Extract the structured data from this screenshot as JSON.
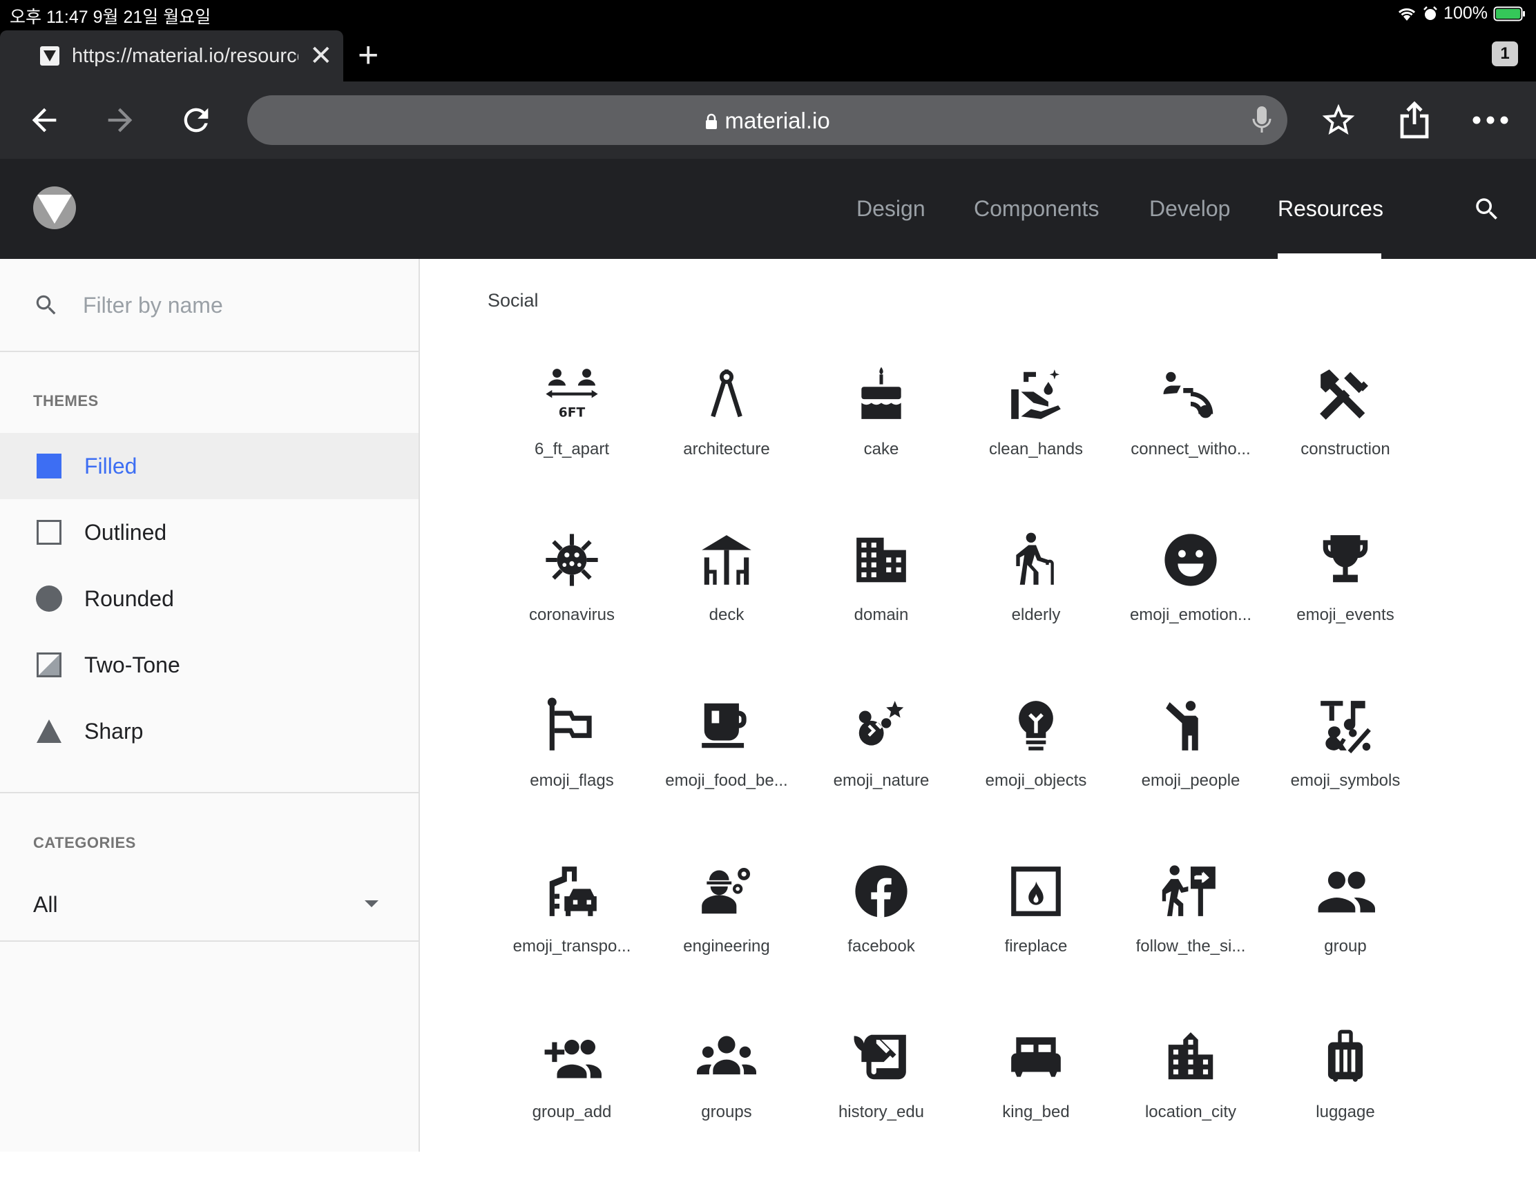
{
  "status_bar": {
    "time_date": "오후 11:47   9월 21일 월요일",
    "battery": "100%"
  },
  "tab": {
    "title": "https://material.io/resources/icons/",
    "close": "✕",
    "new_tab": "+",
    "count": "1"
  },
  "address_bar": {
    "url": "material.io"
  },
  "header": {
    "nav": [
      {
        "label": "Design"
      },
      {
        "label": "Components"
      },
      {
        "label": "Develop"
      },
      {
        "label": "Resources"
      }
    ]
  },
  "sidebar": {
    "filter_placeholder": "Filter by name",
    "themes_label": "THEMES",
    "themes": [
      {
        "label": "Filled"
      },
      {
        "label": "Outlined"
      },
      {
        "label": "Rounded"
      },
      {
        "label": "Two-Tone"
      },
      {
        "label": "Sharp"
      }
    ],
    "selected_theme": "Filled",
    "categories_label": "CATEGORIES",
    "category_value": "All"
  },
  "content": {
    "category": "Social",
    "icons": [
      {
        "name": "6_ft_apart"
      },
      {
        "name": "architecture"
      },
      {
        "name": "cake"
      },
      {
        "name": "clean_hands"
      },
      {
        "name": "connect_witho..."
      },
      {
        "name": "construction"
      },
      {
        "name": "coronavirus"
      },
      {
        "name": "deck"
      },
      {
        "name": "domain"
      },
      {
        "name": "elderly"
      },
      {
        "name": "emoji_emotion..."
      },
      {
        "name": "emoji_events"
      },
      {
        "name": "emoji_flags"
      },
      {
        "name": "emoji_food_be..."
      },
      {
        "name": "emoji_nature"
      },
      {
        "name": "emoji_objects"
      },
      {
        "name": "emoji_people"
      },
      {
        "name": "emoji_symbols"
      },
      {
        "name": "emoji_transpo..."
      },
      {
        "name": "engineering"
      },
      {
        "name": "facebook"
      },
      {
        "name": "fireplace"
      },
      {
        "name": "follow_the_si..."
      },
      {
        "name": "group"
      },
      {
        "name": "group_add"
      },
      {
        "name": "groups"
      },
      {
        "name": "history_edu"
      },
      {
        "name": "king_bed"
      },
      {
        "name": "location_city"
      },
      {
        "name": "luggage"
      }
    ]
  },
  "colors": {
    "accent": "#3d6ef3",
    "header_bg": "#202124",
    "toolbar_bg": "#2a2b2e",
    "sidebar_bg": "#fafafa"
  }
}
